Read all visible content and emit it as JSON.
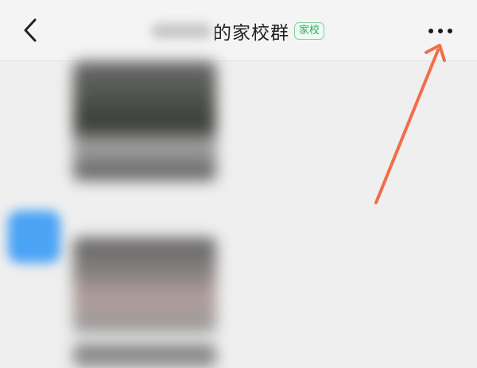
{
  "header": {
    "title": "的家校群",
    "tag": "家校"
  },
  "icons": {
    "back": "back-chevron-icon",
    "more": "more-dots-icon"
  },
  "colors": {
    "tag_text": "#2faa5d",
    "annotation_arrow": "#f26d4a",
    "avatar": "#4aa3f5"
  }
}
